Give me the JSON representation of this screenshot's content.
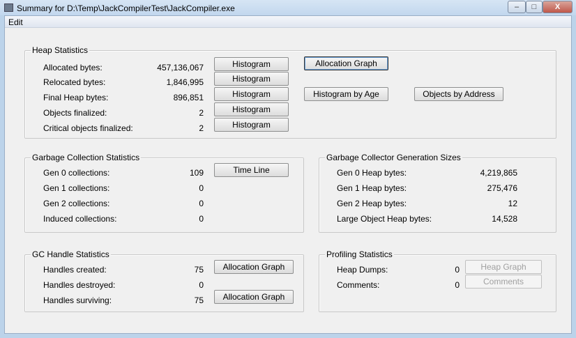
{
  "window": {
    "title": "Summary for D:\\Temp\\JackCompilerTest\\JackCompiler.exe",
    "minimize": "–",
    "maximize": "□",
    "close": "X"
  },
  "menu": {
    "edit": "Edit"
  },
  "heap": {
    "title": "Heap Statistics",
    "rows": [
      {
        "label": "Allocated bytes:",
        "value": "457,136,067",
        "button": "Histogram"
      },
      {
        "label": "Relocated bytes:",
        "value": "1,846,995",
        "button": "Histogram"
      },
      {
        "label": "Final Heap bytes:",
        "value": "896,851",
        "button": "Histogram"
      },
      {
        "label": "Objects finalized:",
        "value": "2",
        "button": "Histogram"
      },
      {
        "label": "Critical objects finalized:",
        "value": "2",
        "button": "Histogram"
      }
    ],
    "allocation_graph": "Allocation Graph",
    "histogram_by_age": "Histogram by Age",
    "objects_by_address": "Objects by Address"
  },
  "gc": {
    "title": "Garbage Collection Statistics",
    "rows": [
      {
        "label": "Gen 0 collections:",
        "value": "109"
      },
      {
        "label": "Gen 1 collections:",
        "value": "0"
      },
      {
        "label": "Gen 2 collections:",
        "value": "0"
      },
      {
        "label": "Induced collections:",
        "value": "0"
      }
    ],
    "time_line": "Time Line"
  },
  "gensizes": {
    "title": "Garbage Collector Generation Sizes",
    "rows": [
      {
        "label": "Gen 0 Heap bytes:",
        "value": "4,219,865"
      },
      {
        "label": "Gen 1 Heap bytes:",
        "value": "275,476"
      },
      {
        "label": "Gen 2 Heap bytes:",
        "value": "12"
      },
      {
        "label": "Large Object Heap bytes:",
        "value": "14,528"
      }
    ]
  },
  "handles": {
    "title": "GC Handle Statistics",
    "rows": [
      {
        "label": "Handles created:",
        "value": "75",
        "button": "Allocation Graph"
      },
      {
        "label": "Handles destroyed:",
        "value": "0"
      },
      {
        "label": "Handles surviving:",
        "value": "75",
        "button": "Allocation Graph"
      }
    ]
  },
  "profiling": {
    "title": "Profiling Statistics",
    "rows": [
      {
        "label": "Heap Dumps:",
        "value": "0",
        "button": "Heap Graph"
      },
      {
        "label": "Comments:",
        "value": "0",
        "button": "Comments"
      }
    ]
  }
}
